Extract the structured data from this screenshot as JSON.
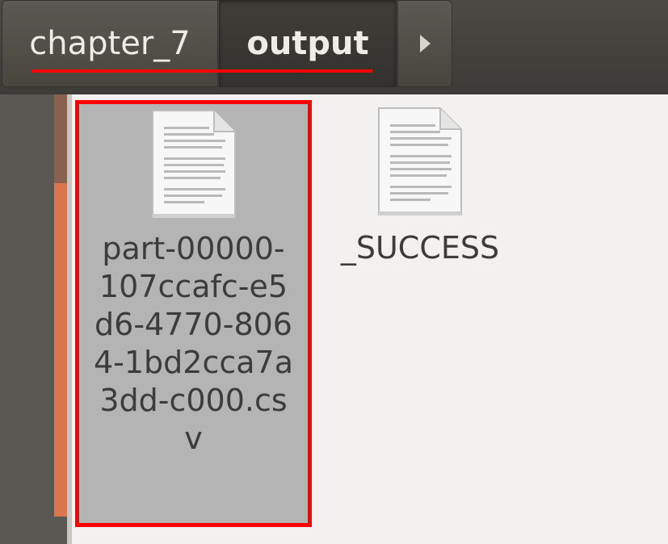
{
  "pathbar": {
    "crumbs": [
      {
        "label": "chapter_7"
      },
      {
        "label": "output"
      }
    ],
    "next_icon": "chevron-right-icon"
  },
  "files": [
    {
      "name": "part-00000-107ccafc-e5d6-4770-8064-1bd2cca7a3dd-c000.csv",
      "icon": "text-document-icon",
      "selected": true
    },
    {
      "name": "_SUCCESS",
      "icon": "text-document-icon",
      "selected": false
    }
  ],
  "colors": {
    "highlight": "#ff0000",
    "selection": "#b4b4b4",
    "toolbar": "#3d3b37",
    "sidebar_accent": "#d9764e"
  }
}
